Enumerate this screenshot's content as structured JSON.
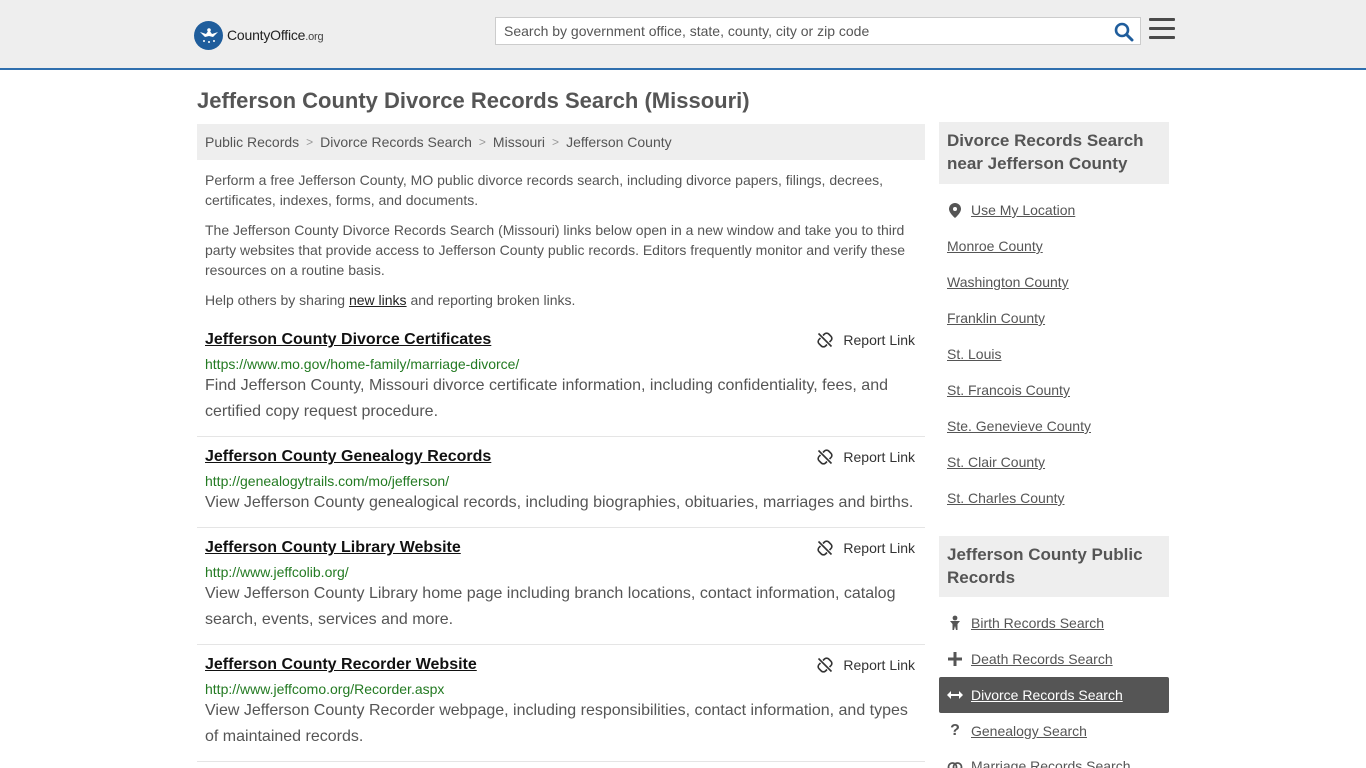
{
  "header": {
    "logo_name": "CountyOffice",
    "logo_tld": ".org",
    "search_placeholder": "Search by government office, state, county, city or zip code",
    "colors": {
      "header_bg": "#eeeeee",
      "accent": "#2f6fae",
      "logo": "#1f5d9c"
    }
  },
  "page": {
    "title": "Jefferson County Divorce Records Search (Missouri)"
  },
  "breadcrumb": [
    {
      "label": "Public Records"
    },
    {
      "label": "Divorce Records Search"
    },
    {
      "label": "Missouri"
    },
    {
      "label": "Jefferson County"
    }
  ],
  "intro": {
    "p1": "Perform a free Jefferson County, MO public divorce records search, including divorce papers, filings, decrees, certificates, indexes, forms, and documents.",
    "p2": "The Jefferson County Divorce Records Search (Missouri) links below open in a new window and take you to third party websites that provide access to Jefferson County public records. Editors frequently monitor and verify these resources on a routine basis.",
    "p3_before": "Help others by sharing ",
    "p3_link": "new links",
    "p3_after": " and reporting broken links."
  },
  "report_label": "Report Link",
  "listings": [
    {
      "title": "Jefferson County Divorce Certificates",
      "url": "https://www.mo.gov/home-family/marriage-divorce/",
      "description": "Find Jefferson County, Missouri divorce certificate information, including confidentiality, fees, and certified copy request procedure."
    },
    {
      "title": "Jefferson County Genealogy Records",
      "url": "http://genealogytrails.com/mo/jefferson/",
      "description": "View Jefferson County genealogical records, including biographies, obituaries, marriages and births."
    },
    {
      "title": "Jefferson County Library Website",
      "url": "http://www.jeffcolib.org/",
      "description": "View Jefferson County Library home page including branch locations, contact information, catalog search, events, services and more."
    },
    {
      "title": "Jefferson County Recorder Website",
      "url": "http://www.jeffcomo.org/Recorder.aspx",
      "description": "View Jefferson County Recorder webpage, including responsibilities, contact information, and types of maintained records."
    }
  ],
  "sidebar": {
    "nearby_heading": "Divorce Records Search near Jefferson County",
    "use_location": "Use My Location",
    "nearby": [
      "Monroe County",
      "Washington County",
      "Franklin County",
      "St. Louis",
      "St. Francois County",
      "Ste. Genevieve County",
      "St. Clair County",
      "St. Charles County"
    ],
    "records_heading": "Jefferson County Public Records",
    "records": [
      {
        "label": "Birth Records Search",
        "icon": "baby-icon"
      },
      {
        "label": "Death Records Search",
        "icon": "cross-icon"
      },
      {
        "label": "Divorce Records Search",
        "icon": "split-arrows-icon",
        "active": true
      },
      {
        "label": "Genealogy Search",
        "icon": "question-icon"
      },
      {
        "label": "Marriage Records Search",
        "icon": "rings-icon"
      }
    ]
  }
}
